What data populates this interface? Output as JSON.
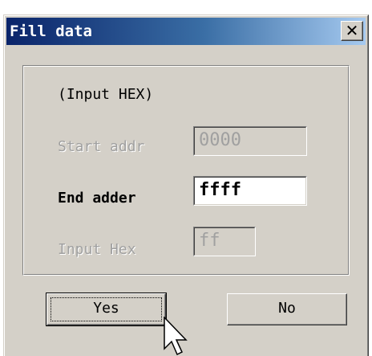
{
  "dialog": {
    "title": "Fill data",
    "close_glyph": "✕"
  },
  "group": {
    "header": "(Input HEX)",
    "start_addr": {
      "label": "Start addr",
      "value": "0000",
      "enabled": false
    },
    "end_adder": {
      "label": "End adder",
      "value": "ffff",
      "enabled": true
    },
    "input_hex": {
      "label": "Input Hex",
      "value": "ff",
      "enabled": false
    }
  },
  "buttons": {
    "yes": "Yes",
    "no": "No"
  },
  "icons": {
    "close": "close-icon",
    "cursor": "mouse-pointer-icon"
  },
  "colors": {
    "title_bar_start": "#0a246a",
    "title_bar_end": "#a6caf0",
    "dialog_face": "#d4d0c8",
    "disabled_text": "#a0a0a0"
  }
}
